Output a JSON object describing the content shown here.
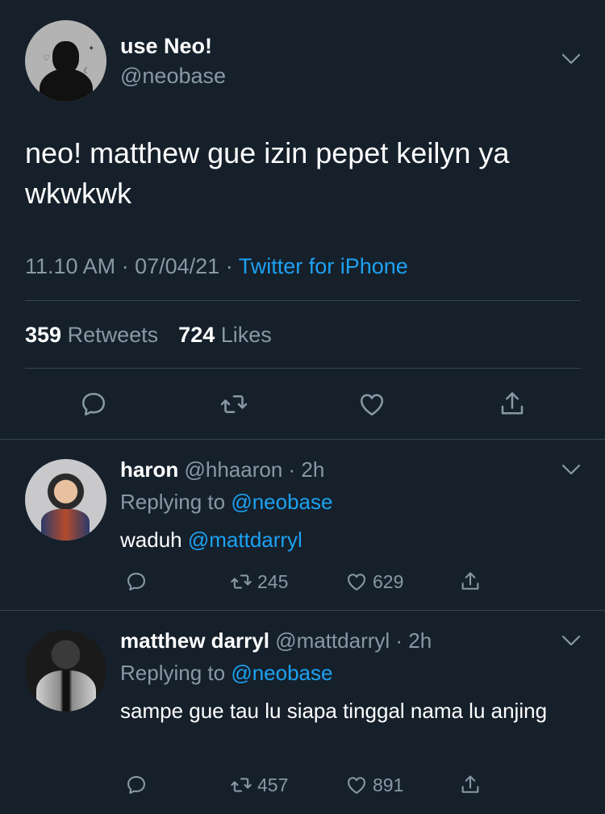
{
  "main_tweet": {
    "display_name": "use Neo!",
    "handle": "@neobase",
    "text": "neo! matthew gue izin pepet keilyn ya wkwkwk",
    "time": "11.10 AM",
    "date": "07/04/21",
    "source": "Twitter for iPhone",
    "retweets": "359",
    "retweets_label": "Retweets",
    "likes": "724",
    "likes_label": "Likes"
  },
  "replies": [
    {
      "display_name": "haron",
      "handle": "@hhaaron",
      "age": "2h",
      "replying_label": "Replying to",
      "replying_to": "@neobase",
      "text": "waduh",
      "mention": "@mattdarryl",
      "retweets": "245",
      "likes": "629"
    },
    {
      "display_name": "matthew darryl",
      "handle": "@mattdarryl",
      "age": "2h",
      "replying_label": "Replying to",
      "replying_to": "@neobase",
      "text": "sampe gue tau lu siapa tinggal nama lu anjing",
      "retweets": "457",
      "likes": "891"
    }
  ],
  "colors": {
    "background": "#15202b",
    "secondary_text": "#8899a6",
    "accent": "#1da1f2",
    "divider": "#38444d"
  },
  "icons": [
    "reply-icon",
    "retweet-icon",
    "like-icon",
    "share-icon",
    "chevron-down-icon"
  ]
}
